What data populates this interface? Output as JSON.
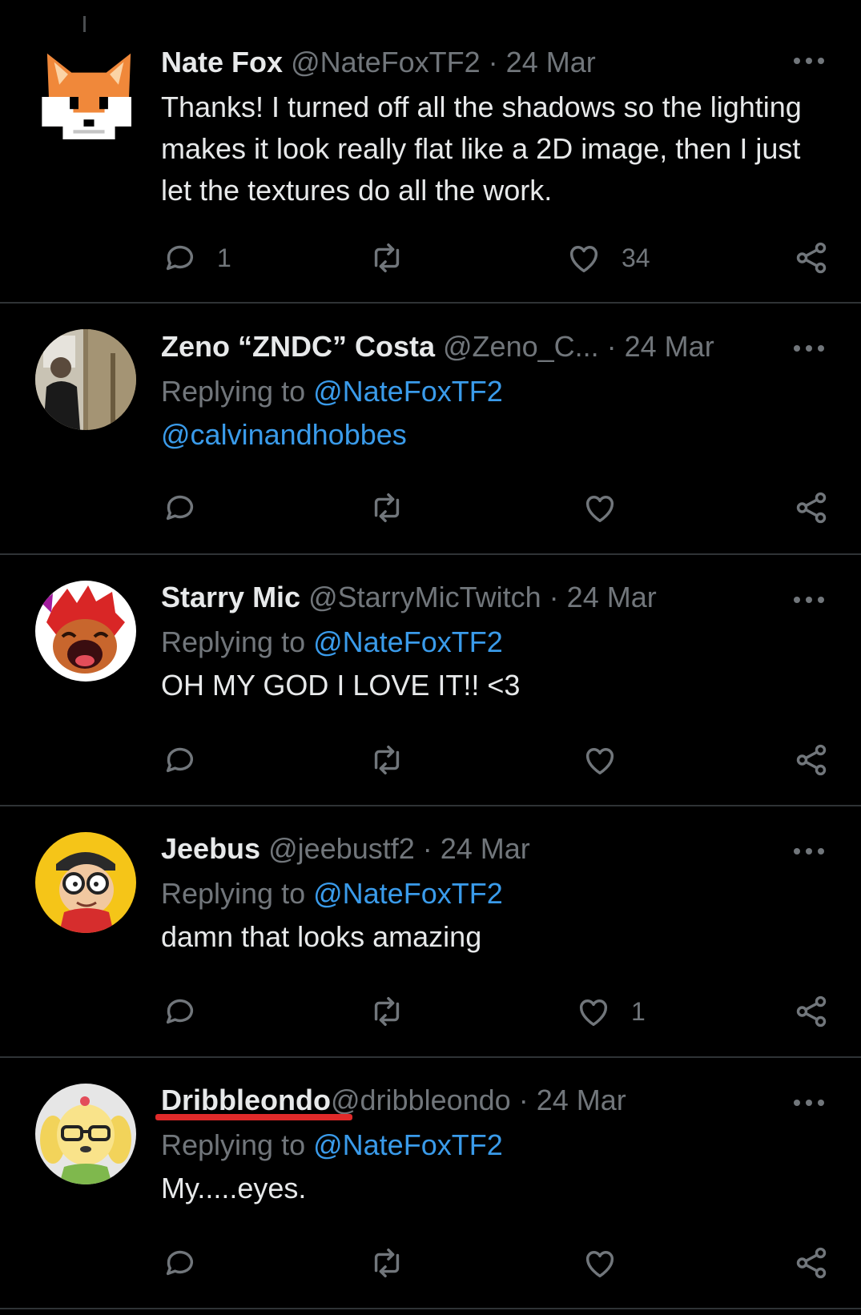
{
  "colors": {
    "background": "#000000",
    "text": "#e7e9ea",
    "muted": "#71767b",
    "link": "#3a9bea",
    "divider": "#2f3336",
    "annotation_underline": "#e02a2a"
  },
  "tweets": [
    {
      "name": "Nate Fox",
      "handle": "@NateFoxTF2",
      "sep": " · ",
      "date": "24 Mar",
      "replying_prefix": "",
      "replying_to": "",
      "text": "Thanks! I turned off all the shadows so the lighting makes it look really flat like a 2D image, then I just let the textures do all the work.",
      "reply_count": "1",
      "retweet_count": "",
      "like_count": "34",
      "avatar_icon": "pixel-fox-avatar"
    },
    {
      "name": "Zeno “ZNDC” Costa",
      "handle": "@Zeno_C...",
      "sep": "  · ",
      "date": "24 Mar",
      "replying_prefix": "Replying to ",
      "replying_to": "@NateFoxTF2",
      "text": "@calvinandhobbes",
      "reply_count": "",
      "retweet_count": "",
      "like_count": "",
      "avatar_icon": "photo-avatar"
    },
    {
      "name": "Starry Mic",
      "handle": "@StarryMicTwitch",
      "sep": " · ",
      "date": "24 Mar",
      "replying_prefix": "Replying to ",
      "replying_to": "@NateFoxTF2",
      "text": "OH MY GOD I LOVE IT!! <3",
      "reply_count": "",
      "retweet_count": "",
      "like_count": "",
      "avatar_icon": "red-cartoon-avatar"
    },
    {
      "name": "Jeebus",
      "handle": "@jeebustf2",
      "sep": " · ",
      "date": "24 Mar",
      "replying_prefix": "Replying to ",
      "replying_to": "@NateFoxTF2",
      "text": "damn that looks amazing",
      "reply_count": "",
      "retweet_count": "",
      "like_count": "1",
      "avatar_icon": "yellow-cartoon-avatar"
    },
    {
      "name": "Dribbleondo",
      "handle": "@dribbleondo",
      "sep": " · ",
      "date": "24 Mar",
      "replying_prefix": "Replying to ",
      "replying_to": "@NateFoxTF2",
      "text": "My.....eyes.",
      "reply_count": "",
      "retweet_count": "",
      "like_count": "",
      "avatar_icon": "dog-character-avatar"
    }
  ]
}
